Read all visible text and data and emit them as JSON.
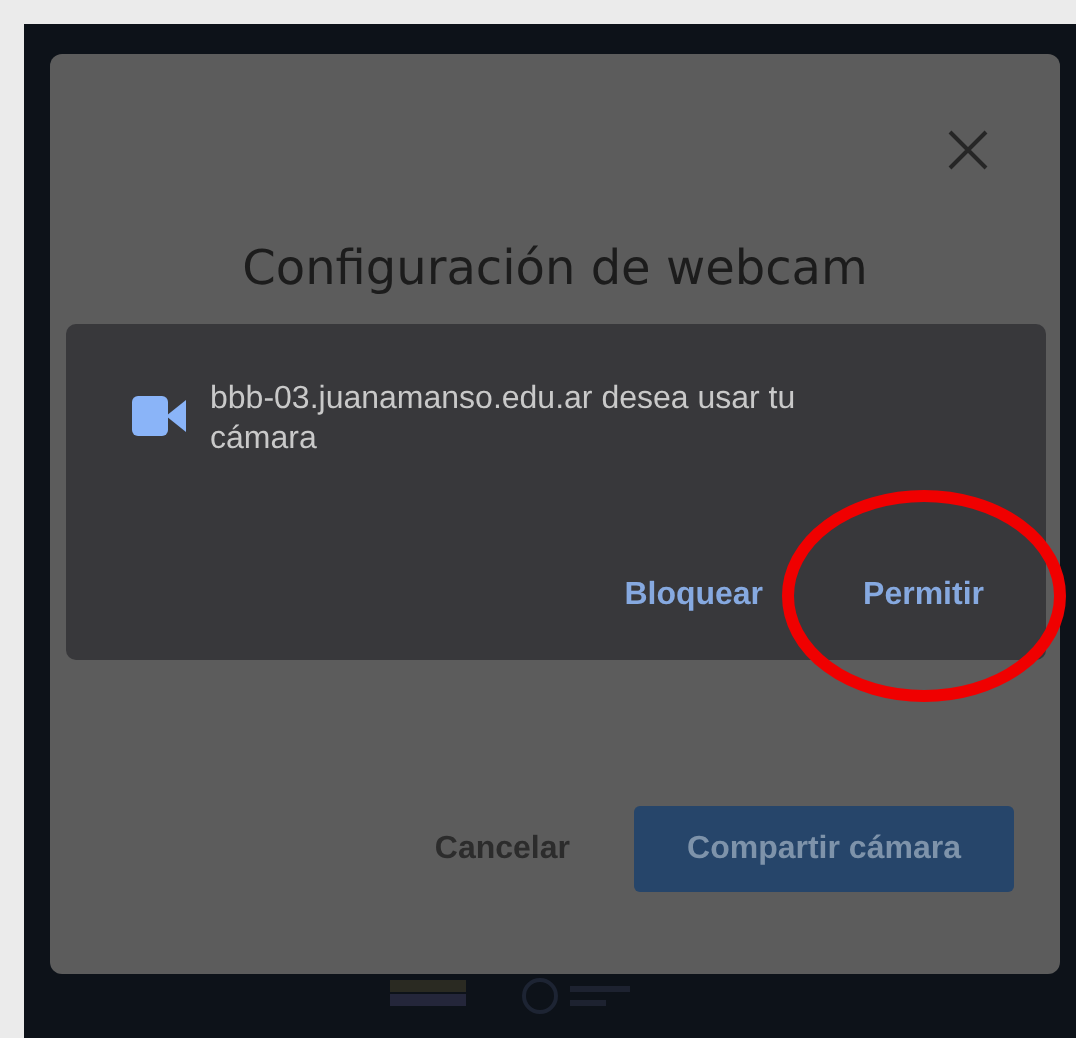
{
  "modal": {
    "title": "Configuración de webcam",
    "buttons": [
      {
        "label": "Cancelar",
        "kind": "link",
        "disabled": false
      },
      {
        "label": "Compartir cámara",
        "kind": "primary",
        "disabled": true
      }
    ]
  },
  "permission_prompt": {
    "message": "bbb-03.juanamanso.edu.ar desea usar tu cámara",
    "buttons": [
      {
        "label": "Bloquear",
        "highlighted": false
      },
      {
        "label": "Permitir",
        "highlighted": true
      }
    ]
  }
}
